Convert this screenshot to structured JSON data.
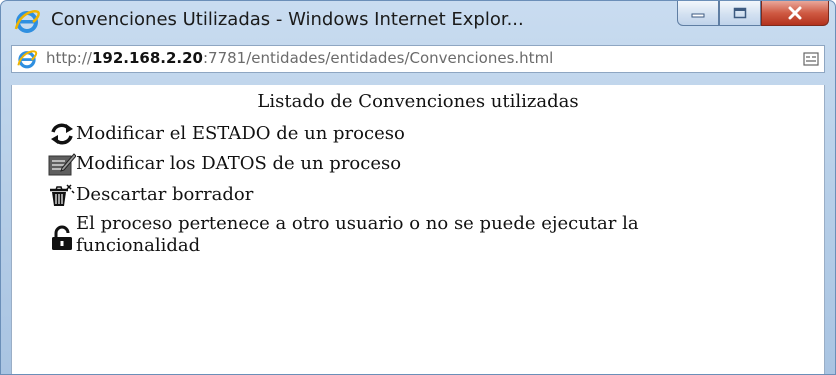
{
  "window": {
    "title": "Convenciones Utilizadas - Windows Internet Explor...",
    "icon": "internet-explorer-icon"
  },
  "caption_buttons": {
    "minimize_icon": "minimize-icon",
    "maximize_icon": "maximize-icon",
    "close_icon": "close-icon"
  },
  "address_bar": {
    "url_prefix": "http://",
    "url_host": "192.168.2.20",
    "url_rest": ":7781/entidades/entidades/Convenciones.html",
    "compat_icon": "compatibility-view-icon"
  },
  "page": {
    "title": "Listado de Convenciones utilizadas",
    "items": [
      {
        "icon": "refresh-arrows-icon",
        "label": "Modificar el ESTADO de un proceso"
      },
      {
        "icon": "edit-document-icon",
        "label": "Modificar los DATOS de un proceso"
      },
      {
        "icon": "trash-icon",
        "label": "Descartar borrador"
      },
      {
        "icon": "padlock-icon",
        "label": "El proceso pertenece a otro usuario o no se puede ejecutar la funcionalidad"
      }
    ]
  },
  "colors": {
    "frame": "#b7cfe8",
    "close_button": "#c8472f",
    "url_host": "#111111",
    "url_muted": "#6b6b6b"
  }
}
